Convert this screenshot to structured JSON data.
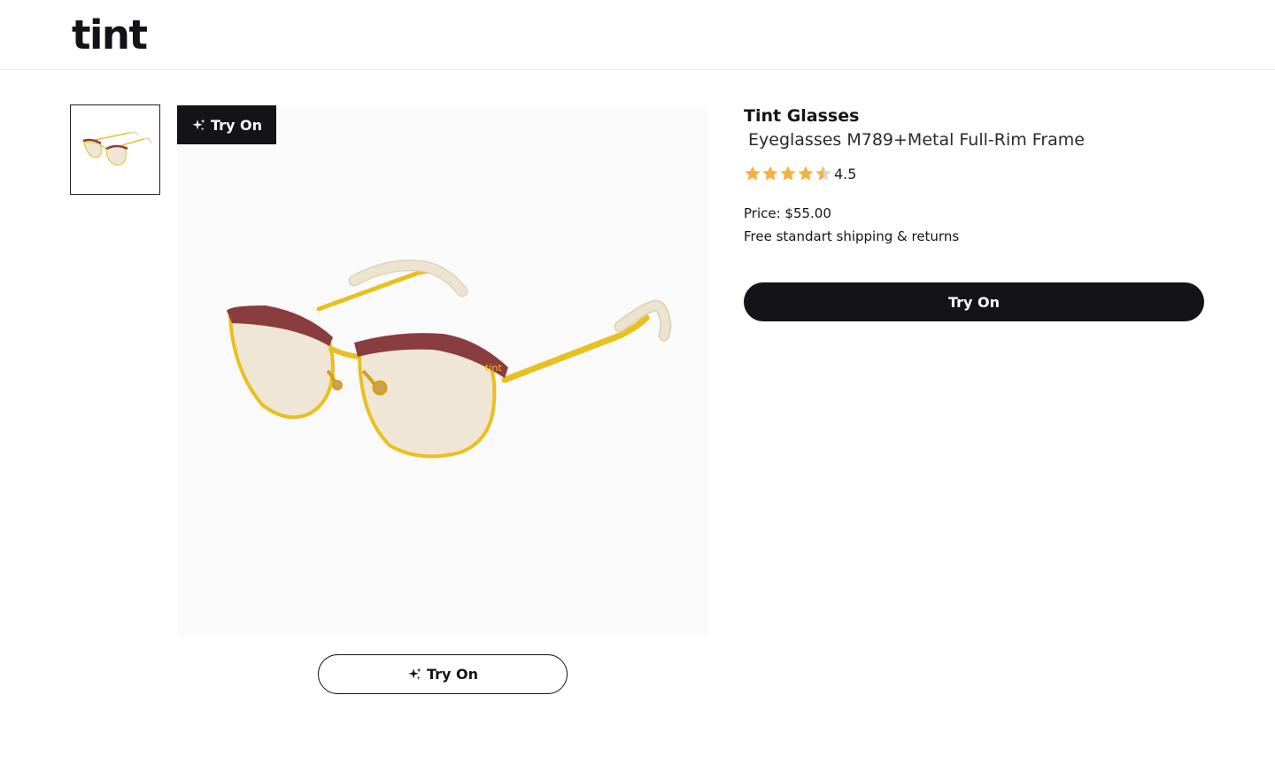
{
  "header": {
    "logo_text": "tint"
  },
  "gallery": {
    "overlay_button_label": "Try On",
    "below_button_label": "Try On"
  },
  "product": {
    "brand": "Tint Glasses",
    "name": "Eyeglasses M789+Metal Full-Rim Frame",
    "rating": {
      "value": "4.5",
      "stars_filled": 4.5,
      "stars_total": 5
    },
    "price": "Price: $55.00",
    "shipping": "Free standart shipping & returns",
    "try_on_label": "Try On"
  },
  "colors": {
    "primary": "#141418",
    "star": "#f5b041",
    "star_empty": "#d6d6d6",
    "frame_top": "#8a3d3f",
    "frame_metal": "#e8c020",
    "lens": "#f0e6d6",
    "temple_tip": "#ece4d0"
  },
  "icons": {
    "sparkle": "sparkle-icon",
    "star": "star-icon"
  }
}
